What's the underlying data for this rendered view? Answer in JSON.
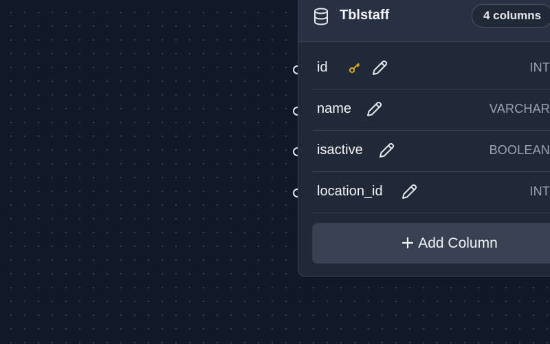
{
  "table": {
    "title": "Tblstaff",
    "column_count": "4 columns",
    "columns": [
      {
        "name": "id",
        "type": "INT",
        "primary_key": true
      },
      {
        "name": "name",
        "type": "VARCHAR",
        "primary_key": false
      },
      {
        "name": "isactive",
        "type": "BOOLEAN",
        "primary_key": false
      },
      {
        "name": "location_id",
        "type": "INT",
        "primary_key": false
      }
    ],
    "add_column_label": "Add Column",
    "more_glyph": "••"
  },
  "colors": {
    "canvas": "#111827",
    "node": "#1f2937",
    "header": "#273142",
    "key": "#eab308",
    "text": "#f3f4f6",
    "muted": "#9ca3af"
  },
  "icons": [
    "database-icon",
    "key-icon",
    "pencil-icon",
    "plus-icon",
    "more-icon"
  ]
}
